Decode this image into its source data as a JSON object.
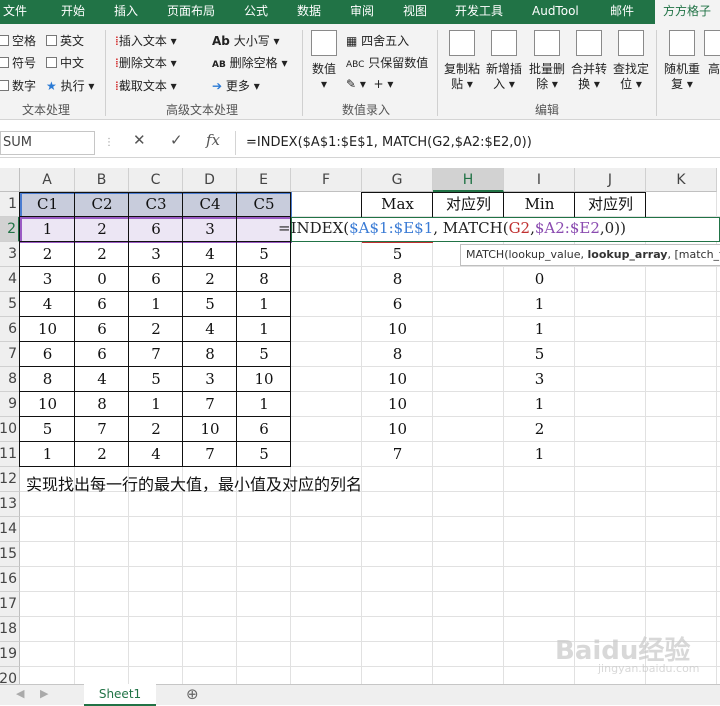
{
  "tabs": [
    "文件",
    "开始",
    "插入",
    "页面布局",
    "公式",
    "数据",
    "审阅",
    "视图",
    "开发工具",
    "AudTool",
    "邮件",
    "方方格子"
  ],
  "ribbon": {
    "checks": [
      "空格",
      "符号",
      "数字"
    ],
    "checks2": [
      "英文",
      "中文"
    ],
    "exec": "执行",
    "text_group_label": "文本处理",
    "adv_items": [
      "插入文本",
      "删除文本",
      "截取文本"
    ],
    "adv_items2": [
      "大小写",
      "删除空格",
      "更多"
    ],
    "adv_group_label": "高级文本处理",
    "num_big": "数值",
    "num_items": [
      "四舍五入",
      "只保留数值"
    ],
    "num_group_label": "数值录入",
    "edit_big": [
      "复制粘\n贴",
      "新增插\n入",
      "批量删\n除",
      "合并转\n换",
      "查找定\n位"
    ],
    "edit_group_label": "编辑",
    "right_big": [
      "随机重\n复",
      "高"
    ]
  },
  "formula_bar": {
    "name_box": "SUM",
    "cancel": "✕",
    "enter": "✓",
    "fx": "fx",
    "formula": "=INDEX($A$1:$E$1, MATCH(G2,$A2:$E2,0))"
  },
  "grid": {
    "columns": [
      "A",
      "B",
      "C",
      "D",
      "E",
      "F",
      "G",
      "H",
      "I",
      "J",
      "K"
    ],
    "rows": [
      "1",
      "2",
      "3",
      "4",
      "5",
      "6",
      "7",
      "8",
      "9",
      "10",
      "11",
      "12",
      "13",
      "14",
      "15",
      "16",
      "17",
      "18",
      "19",
      "20"
    ],
    "headers": [
      "C1",
      "C2",
      "C3",
      "C4",
      "C5"
    ],
    "data": [
      [
        "1",
        "2",
        "6",
        "3",
        ""
      ],
      [
        "2",
        "2",
        "3",
        "4",
        "5"
      ],
      [
        "3",
        "0",
        "6",
        "2",
        "8"
      ],
      [
        "4",
        "6",
        "1",
        "5",
        "1"
      ],
      [
        "10",
        "6",
        "2",
        "4",
        "1"
      ],
      [
        "6",
        "6",
        "7",
        "8",
        "5"
      ],
      [
        "8",
        "4",
        "5",
        "3",
        "10"
      ],
      [
        "10",
        "8",
        "1",
        "7",
        "1"
      ],
      [
        "5",
        "7",
        "2",
        "10",
        "6"
      ],
      [
        "1",
        "2",
        "4",
        "7",
        "5"
      ]
    ],
    "g_header": "Max",
    "h_header": "对应列",
    "i_header": "Min",
    "j_header": "对应列",
    "g_values": [
      "",
      "5",
      "8",
      "6",
      "10",
      "8",
      "10",
      "10",
      "10",
      "7"
    ],
    "i_values": [
      "",
      "",
      "0",
      "1",
      "1",
      "5",
      "3",
      "1",
      "2",
      "1"
    ],
    "note": "实现找出每一行的最大值，最小值及对应的列名"
  },
  "edit_formula": {
    "p1": "=INDEX(",
    "p2": "$A$1:$E$1",
    "p3": ", MATCH(",
    "p4": "G2",
    "p5": ",",
    "p6": "$A2:$E",
    "p7": "2",
    "p8": ",0))"
  },
  "tooltip": {
    "pre": "MATCH(lookup_value, ",
    "bold": "lookup_array",
    "post": ", [match_type])"
  },
  "sheet_tab": "Sheet1",
  "add_sheet": "⊕",
  "watermark": "Baidu经验",
  "watermark_sub": "jingyan.baidu.com"
}
